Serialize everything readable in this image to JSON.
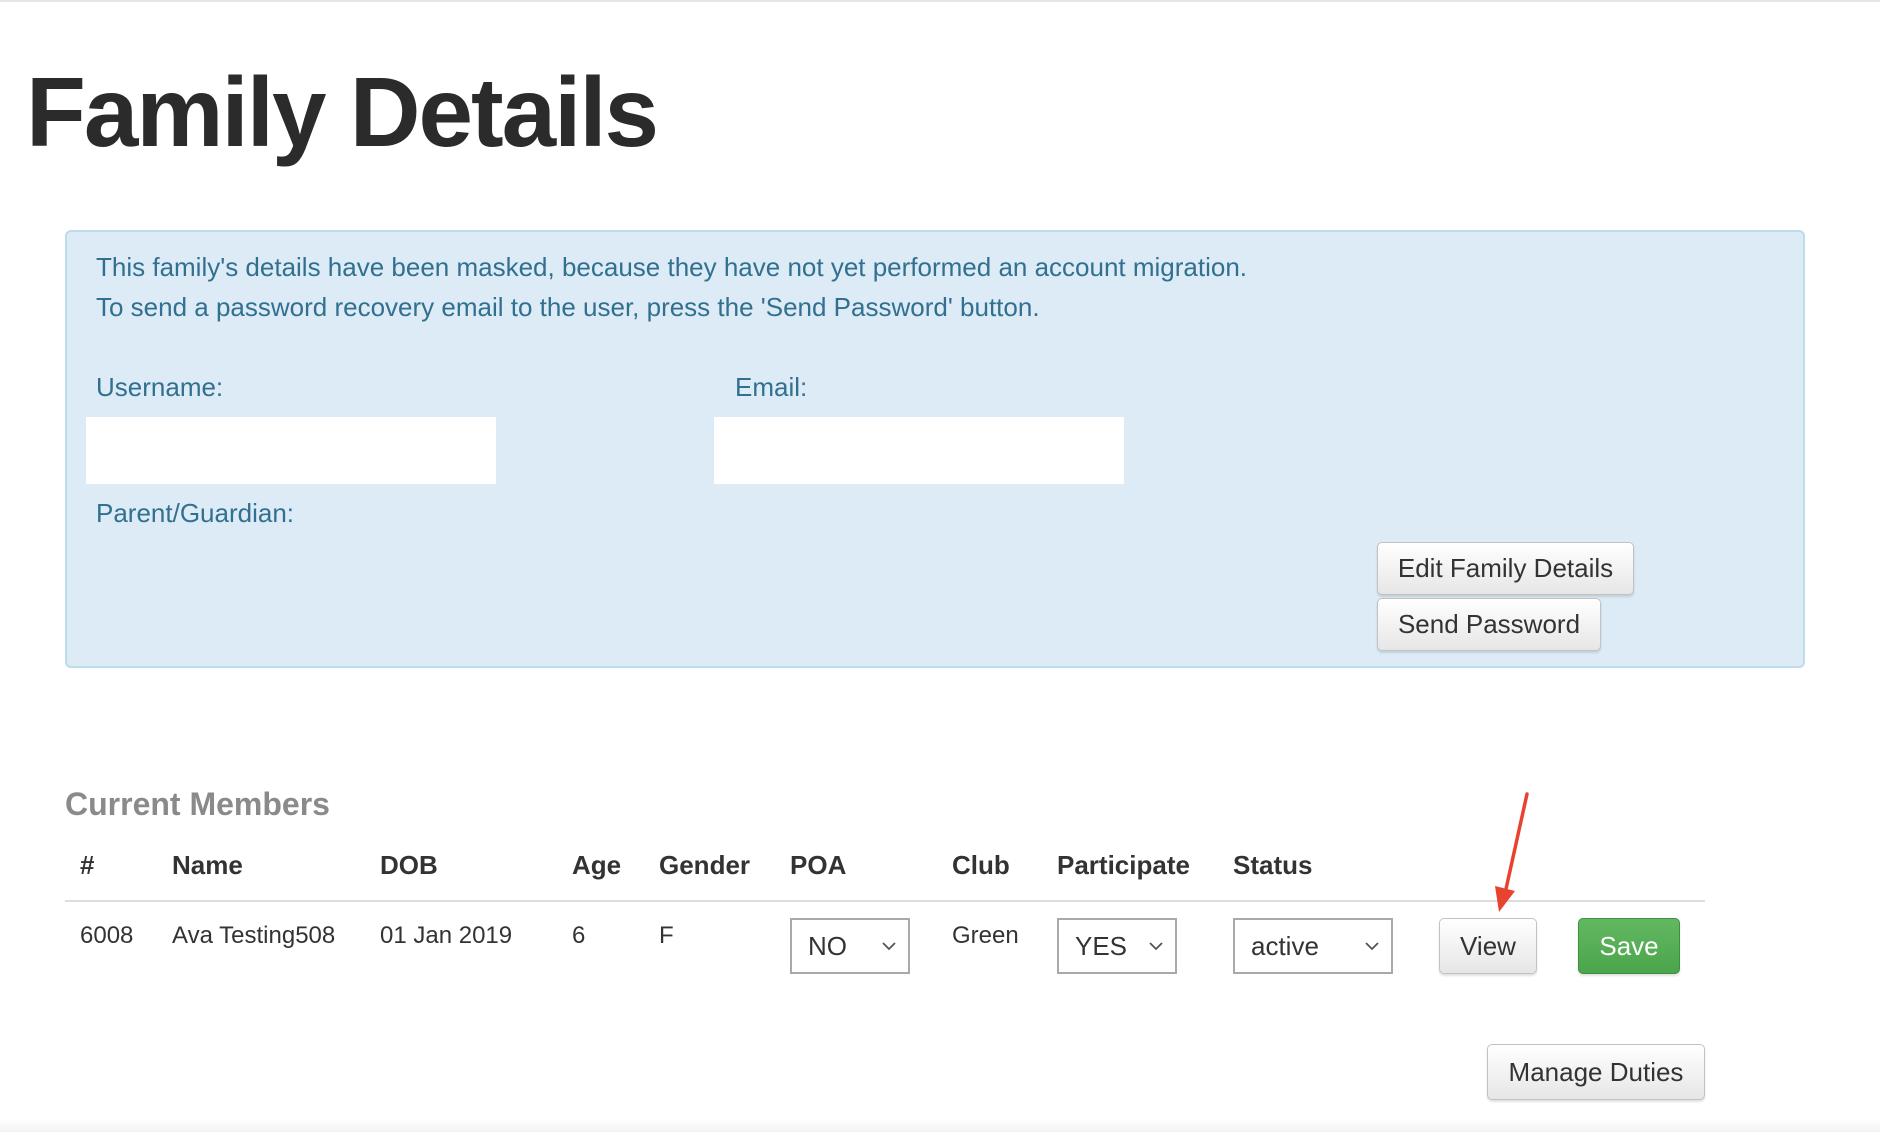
{
  "page": {
    "title": "Family Details"
  },
  "notice": {
    "line1": "This family's details have been masked, because they have not yet performed an account migration.",
    "line2": "To send a password recovery email to the user, press the 'Send Password' button."
  },
  "fields": {
    "username_label": "Username:",
    "email_label": "Email:",
    "parent_label": "Parent/Guardian:"
  },
  "actions": {
    "edit_family": "Edit Family Details",
    "send_password": "Send Password"
  },
  "members": {
    "title": "Current Members",
    "columns": [
      "#",
      "Name",
      "DOB",
      "Age",
      "Gender",
      "POA",
      "Club",
      "Participate",
      "Status"
    ],
    "rows": [
      {
        "id": "6008",
        "name": "Ava Testing508",
        "dob": "01 Jan 2019",
        "age": "6",
        "gender": "F",
        "poa": "NO",
        "club": "Green",
        "participate": "YES",
        "status": "active",
        "view_label": "View",
        "save_label": "Save"
      }
    ],
    "manage_duties": "Manage Duties"
  },
  "colors": {
    "panel_bg": "#dcebf6",
    "panel_text": "#31708f",
    "save_green": "#4ba54b",
    "annotation_red": "#e8432f"
  },
  "icons": {
    "select_chevron": "chevron-down-icon",
    "annotation": "red-arrow-annotation"
  }
}
